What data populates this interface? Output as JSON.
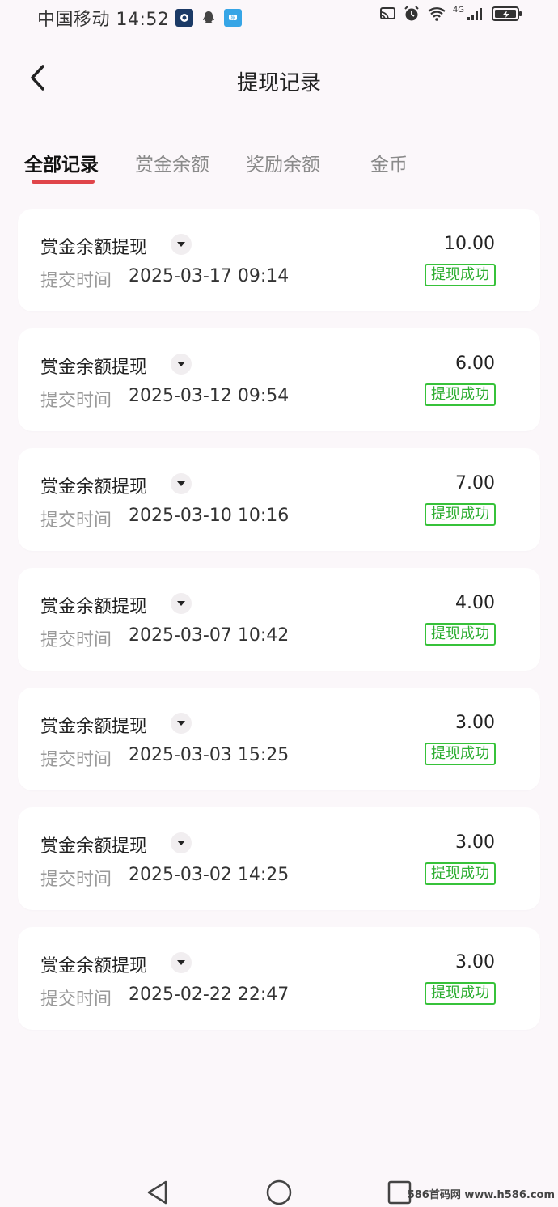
{
  "status_bar": {
    "carrier_time": "中国移动 14:52",
    "network": "4G"
  },
  "header": {
    "title": "提现记录"
  },
  "tabs": [
    {
      "label": "全部记录",
      "active": true
    },
    {
      "label": "赏金余额",
      "active": false
    },
    {
      "label": "奖励余额",
      "active": false
    },
    {
      "label": "金币",
      "active": false
    }
  ],
  "records": [
    {
      "type": "赏金余额提现",
      "time_label": "提交时间",
      "time": "2025-03-17 09:14",
      "amount": "10.00",
      "status": "提现成功"
    },
    {
      "type": "赏金余额提现",
      "time_label": "提交时间",
      "time": "2025-03-12 09:54",
      "amount": "6.00",
      "status": "提现成功"
    },
    {
      "type": "赏金余额提现",
      "time_label": "提交时间",
      "time": "2025-03-10 10:16",
      "amount": "7.00",
      "status": "提现成功"
    },
    {
      "type": "赏金余额提现",
      "time_label": "提交时间",
      "time": "2025-03-07 10:42",
      "amount": "4.00",
      "status": "提现成功"
    },
    {
      "type": "赏金余额提现",
      "time_label": "提交时间",
      "time": "2025-03-03 15:25",
      "amount": "3.00",
      "status": "提现成功"
    },
    {
      "type": "赏金余额提现",
      "time_label": "提交时间",
      "time": "2025-03-02 14:25",
      "amount": "3.00",
      "status": "提现成功"
    },
    {
      "type": "赏金余额提现",
      "time_label": "提交时间",
      "time": "2025-02-22 22:47",
      "amount": "3.00",
      "status": "提现成功"
    }
  ],
  "watermark": "586首码网 www.h586.com",
  "colors": {
    "accent": "#e0454a",
    "success": "#37c23a"
  }
}
